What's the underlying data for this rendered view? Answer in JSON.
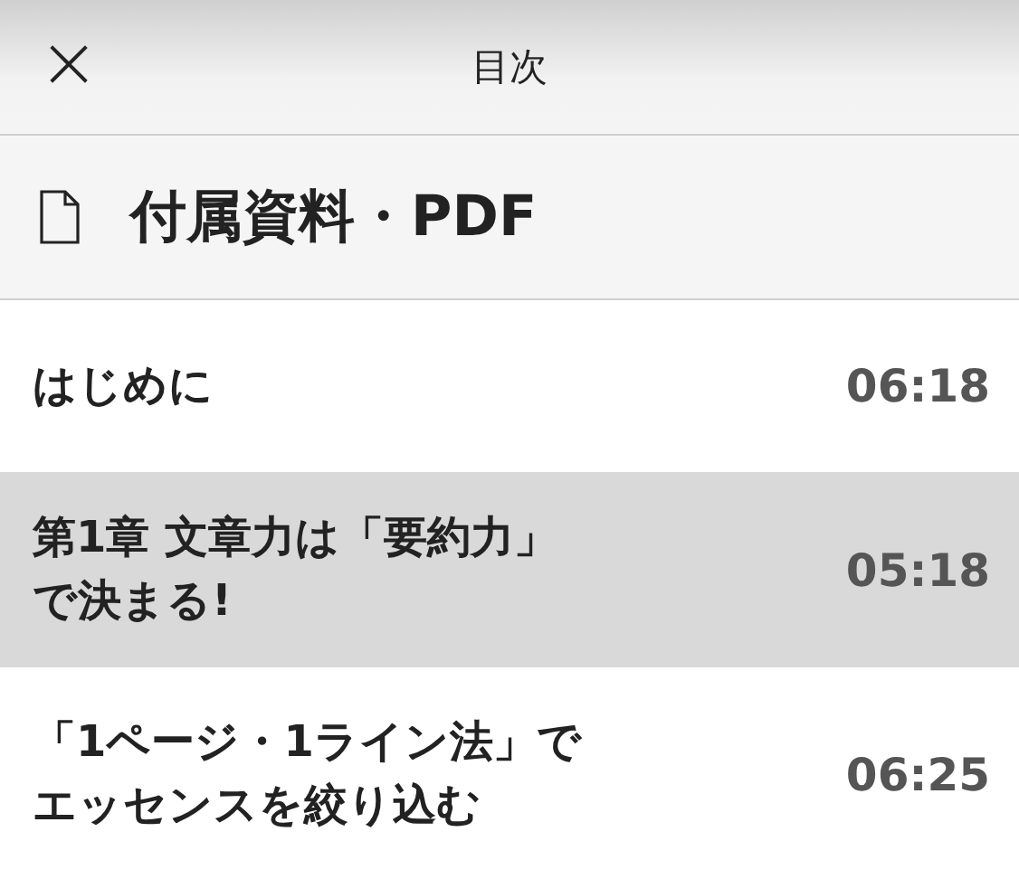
{
  "header": {
    "close": "×",
    "title": "目次"
  },
  "attachment": {
    "label": "付属資料・PDF"
  },
  "chapters": [
    {
      "title": "はじめに",
      "time": "06:18",
      "selected": false
    },
    {
      "title": "第1章 文章力は「要約力」で決まる!",
      "time": "05:18",
      "selected": true
    },
    {
      "title": "「1ページ・1ライン法」でエッセンスを絞り込む",
      "time": "06:25",
      "selected": false
    }
  ]
}
